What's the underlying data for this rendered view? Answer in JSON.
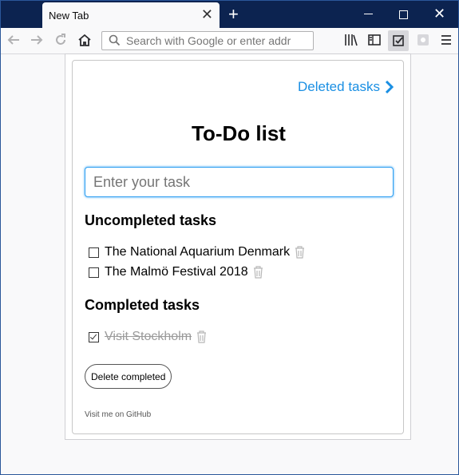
{
  "browser": {
    "tab_title": "New Tab",
    "tab_close_glyph": "✕",
    "new_tab_glyph": "+",
    "close_glyph": "✕",
    "url_placeholder": "Search with Google or enter addr",
    "accent": "#0c2350"
  },
  "popup": {
    "deleted_link": "Deleted tasks",
    "title": "To-Do list",
    "input_placeholder": "Enter your task",
    "uncompleted_heading": "Uncompleted tasks",
    "uncompleted": [
      {
        "text": "The National Aquarium Denmark",
        "checked": false
      },
      {
        "text": "The Malmö Festival 2018",
        "checked": false
      }
    ],
    "completed_heading": "Completed tasks",
    "completed": [
      {
        "text": "Visit Stockholm",
        "checked": true
      }
    ],
    "delete_button": "Delete completed",
    "footer_link": "Visit me on GitHub",
    "link_color": "#1a8fe3"
  }
}
